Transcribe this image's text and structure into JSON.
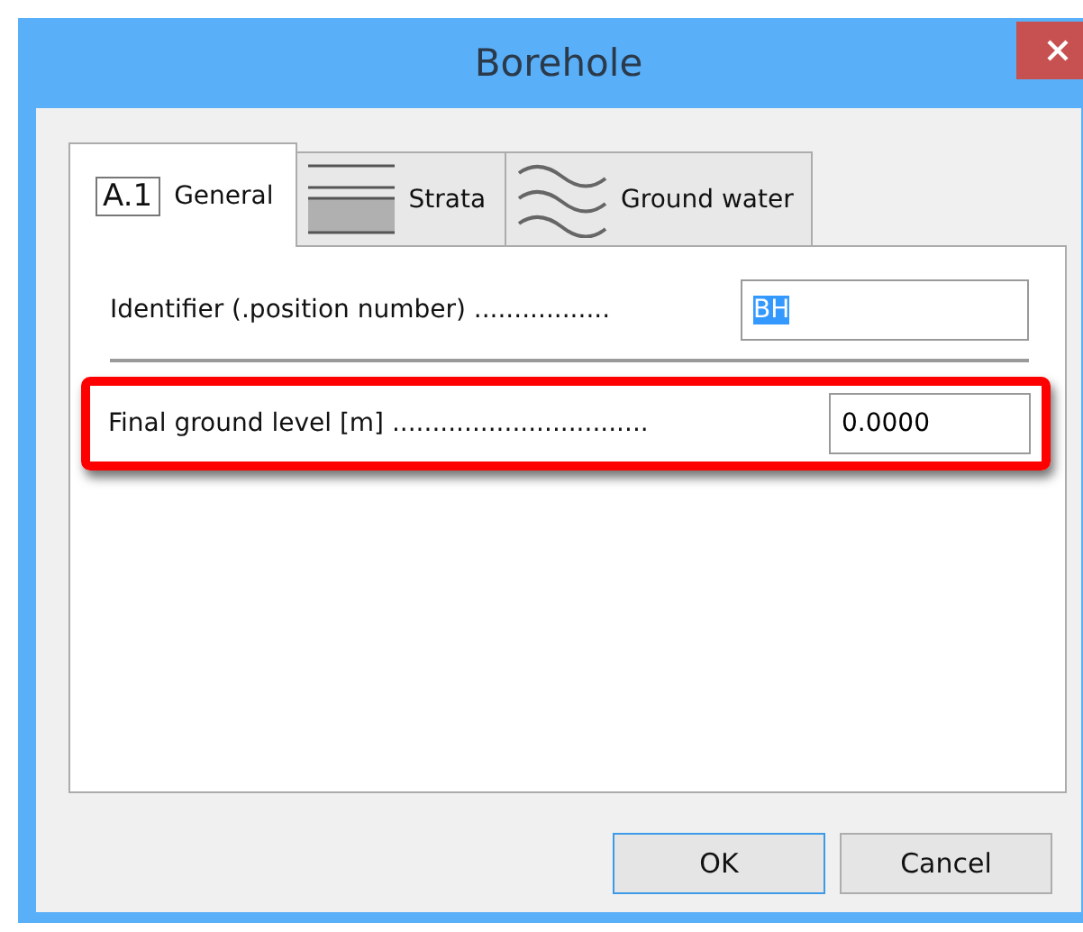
{
  "window": {
    "title": "Borehole"
  },
  "tabs": [
    {
      "label": "General",
      "kind": "code",
      "icon_text": "A.1",
      "selected": true
    },
    {
      "label": "Strata",
      "kind": "layers",
      "selected": false
    },
    {
      "label": "Ground water",
      "kind": "waves",
      "selected": false
    }
  ],
  "fields": [
    {
      "label": "Identifier (.position number) .................",
      "value": "BH",
      "text_selected": true,
      "highlighted": false
    },
    {
      "label": "Final ground level  [m] ................................",
      "value": "0.0000",
      "text_selected": false,
      "highlighted": true
    }
  ],
  "buttons": [
    {
      "label": "OK",
      "selected": true
    },
    {
      "label": "Cancel",
      "selected": false
    }
  ]
}
